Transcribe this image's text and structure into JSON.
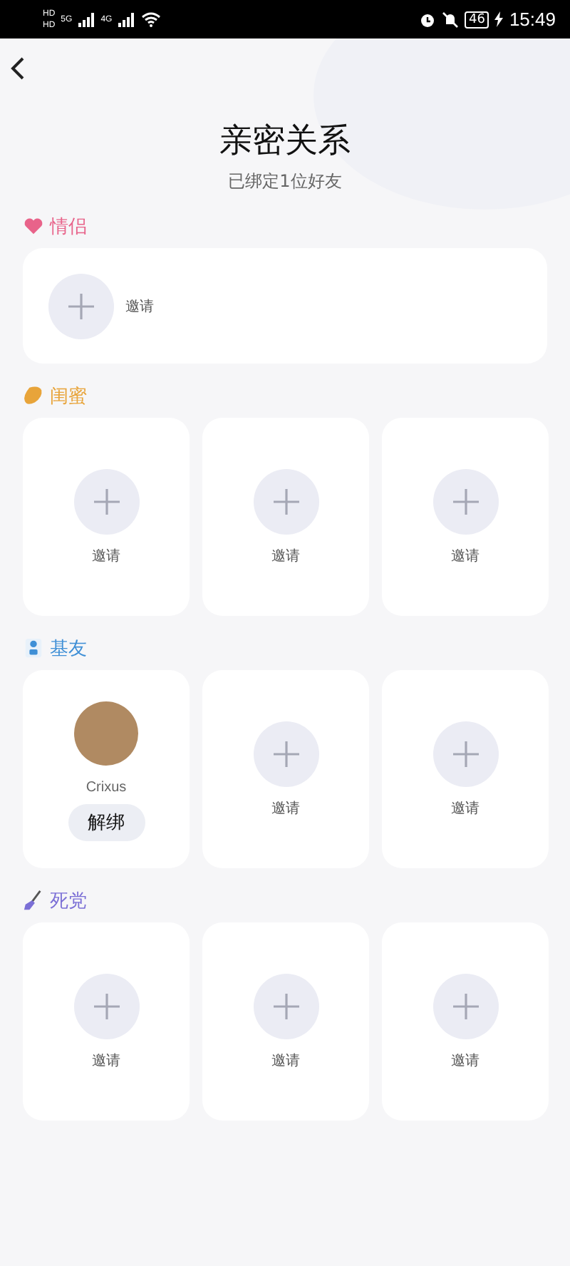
{
  "status_bar": {
    "sim_labels": [
      "HD",
      "HD"
    ],
    "networks": [
      "5G",
      "4G"
    ],
    "battery": "46",
    "time": "15:49"
  },
  "header": {
    "title": "亲密关系",
    "subtitle": "已绑定1位好友"
  },
  "sections": [
    {
      "title": "情侣",
      "color": "#e8638a",
      "kind": "wide",
      "slots": [
        {
          "kind": "invite",
          "label": "邀请"
        }
      ]
    },
    {
      "title": "闺蜜",
      "color": "#e8a43a",
      "kind": "grid",
      "slots": [
        {
          "kind": "invite",
          "label": "邀请"
        },
        {
          "kind": "invite",
          "label": "邀请"
        },
        {
          "kind": "invite",
          "label": "邀请"
        }
      ]
    },
    {
      "title": "基友",
      "color": "#3f8fd6",
      "kind": "grid",
      "slots": [
        {
          "kind": "friend",
          "name": "Crixus",
          "action": "解绑"
        },
        {
          "kind": "invite",
          "label": "邀请"
        },
        {
          "kind": "invite",
          "label": "邀请"
        }
      ]
    },
    {
      "title": "死党",
      "color": "#7b6fd6",
      "kind": "grid",
      "slots": [
        {
          "kind": "invite",
          "label": "邀请"
        },
        {
          "kind": "invite",
          "label": "邀请"
        },
        {
          "kind": "invite",
          "label": "邀请"
        }
      ]
    }
  ]
}
